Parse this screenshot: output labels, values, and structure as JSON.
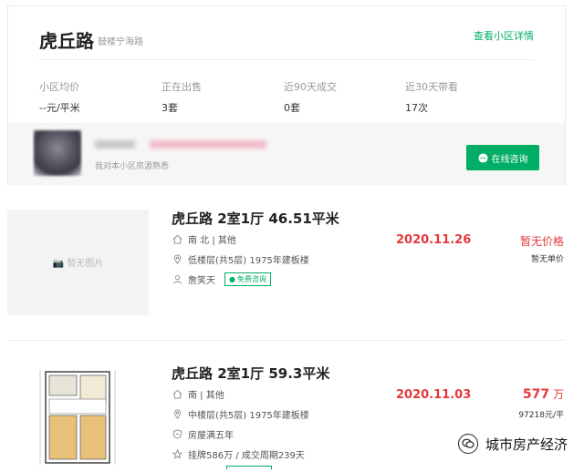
{
  "community": {
    "name": "虎丘路",
    "district": "鼓楼宁海路",
    "detail_link": "查看小区详情",
    "stats": [
      {
        "label": "小区均价",
        "value": "--元/平米"
      },
      {
        "label": "正在出售",
        "value": "3套"
      },
      {
        "label": "近90天成交",
        "value": "0套"
      },
      {
        "label": "近30天带看",
        "value": "17次"
      }
    ],
    "agent": {
      "desc": "我对本小区房源熟悉",
      "consult_label": "在线咨询"
    }
  },
  "listings": [
    {
      "title": "虎丘路 2室1厅 46.51平米",
      "no_image_text": "暂无图片",
      "orientation": "南 北 | 其他",
      "floor": "低楼层(共5层) 1975年建板楼",
      "agent_name": "詹笑天",
      "tag_label": "免费咨询",
      "date": "2020.11.26",
      "price": "暂无价格",
      "unit_price": "暂无单价"
    },
    {
      "title": "虎丘路 2室1厅 59.3平米",
      "orientation": "南 | 其他",
      "floor": "中楼层(共5层) 1975年建板楼",
      "feature": "房屋满五年",
      "deal_info": "挂牌586万 / 成交周期239天",
      "date": "2020.11.03",
      "price_value": "577",
      "price_unit": "万",
      "unit_price": "97218元/平"
    }
  ],
  "watermark": "城市房产经济",
  "colors": {
    "accent": "#00ae66",
    "price": "#e4393c"
  }
}
